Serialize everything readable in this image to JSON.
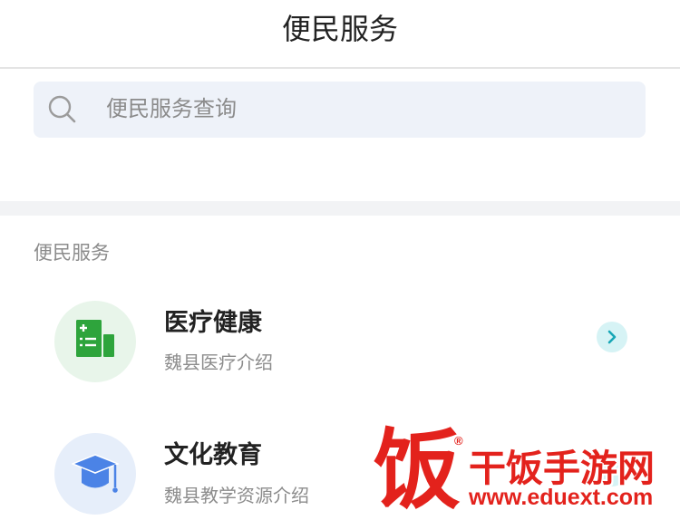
{
  "header": {
    "title": "便民服务"
  },
  "search": {
    "placeholder": "便民服务查询",
    "value": "",
    "icon": "search-icon"
  },
  "section": {
    "label": "便民服务"
  },
  "services": [
    {
      "title": "医疗健康",
      "subtitle": "魏县医疗介绍",
      "icon": "medical-document-icon",
      "action_icon": "chevron-right-icon"
    },
    {
      "title": "文化教育",
      "subtitle": "魏县教学资源介绍",
      "icon": "graduation-cap-icon",
      "action_icon": "chevron-right-icon"
    }
  ],
  "colors": {
    "text_primary": "#222222",
    "text_secondary": "#8c8c8c",
    "placeholder": "#8b8b8b",
    "search_bg": "#eef2f9",
    "divider": "#f2f3f5",
    "medical_icon": "#2ea43c",
    "medical_icon_bg": "#e8f5ea",
    "education_icon": "#4b83e6",
    "education_icon_bg": "#e6eefa",
    "chevron": "#17a7b6",
    "chevron_bg": "#d6f3f5",
    "watermark_red": "#e3221c"
  },
  "watermark": {
    "logo_char": "饭",
    "registered_mark": "®",
    "site_name": "干饭手游网",
    "url": "www.eduext.com"
  }
}
